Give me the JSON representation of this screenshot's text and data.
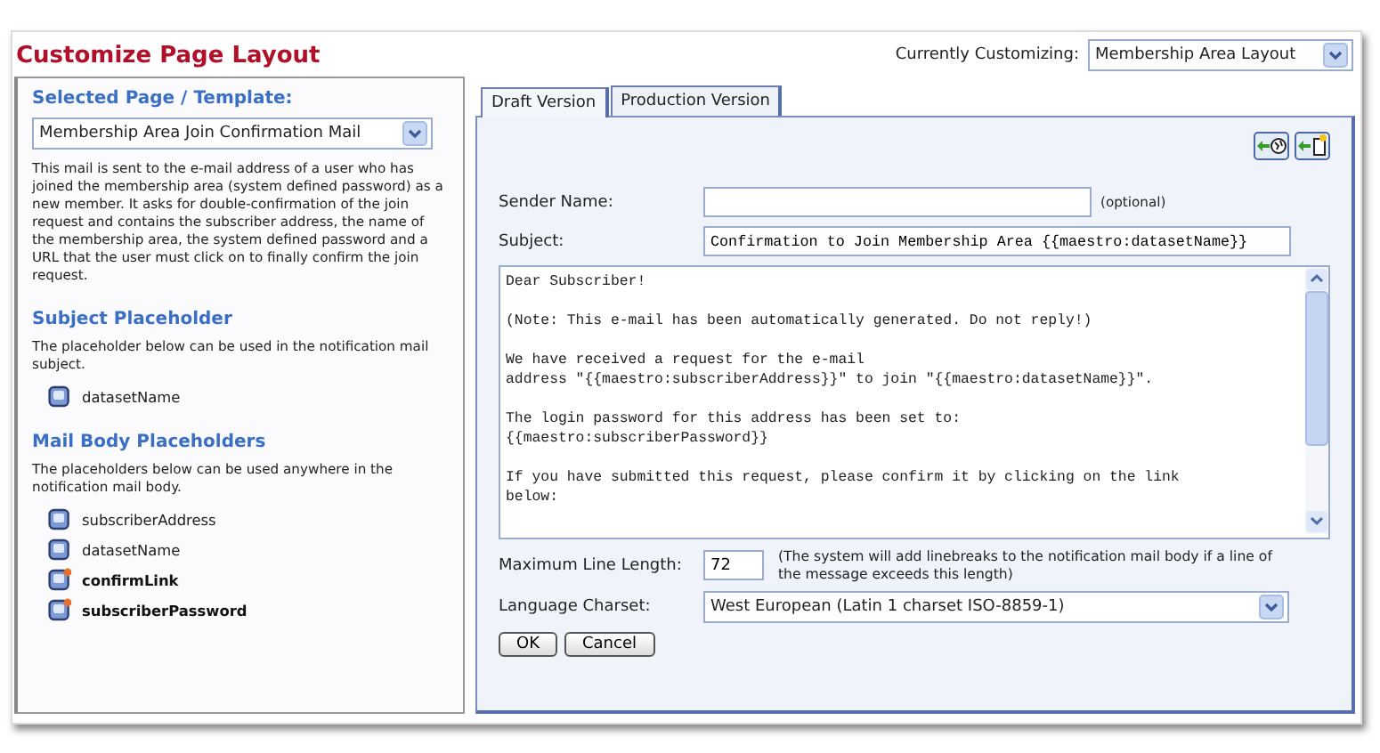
{
  "title": "Customize Page Layout",
  "customizing": {
    "label": "Currently Customizing:",
    "value": "Membership Area Layout"
  },
  "sidebar": {
    "heading": "Selected Page / Template:",
    "template": "Membership Area Join Confirmation Mail",
    "description": "This mail is sent to the e-mail address of a user who has joined the membership area (system defined password) as a new member. It asks for double-confirmation of the join request and contains the subscriber address, the name of the membership area, the system defined password and a URL that the user must click on to finally confirm the join request.",
    "sections": [
      {
        "heading": "Subject Placeholder",
        "note": "The placeholder below can be used in the notification mail subject.",
        "items": [
          {
            "label": "datasetName",
            "required": false
          }
        ]
      },
      {
        "heading": "Mail Body Placeholders",
        "note": "The placeholders below can be used anywhere in the notification mail body.",
        "items": [
          {
            "label": "subscriberAddress",
            "required": false
          },
          {
            "label": "datasetName",
            "required": false
          },
          {
            "label": "confirmLink",
            "required": true
          },
          {
            "label": "subscriberPassword",
            "required": true
          }
        ]
      }
    ]
  },
  "tabs": [
    {
      "label": "Draft Version",
      "selected": true
    },
    {
      "label": "Production Version",
      "selected": false
    }
  ],
  "form": {
    "sender": {
      "label": "Sender Name:",
      "hint": "(optional)"
    },
    "subject": {
      "label": "Subject:",
      "value": "Confirmation to Join Membership Area {{maestro:datasetName}}"
    },
    "body": [
      [
        "Dear Subscriber!"
      ],
      [
        "(Note: This e-mail has been automatically generated. Do not reply!)"
      ],
      [
        "We have received a request for the e-mail",
        "address \"{{maestro:subscriberAddress}}\" to join \"{{maestro:datasetName}}\"."
      ],
      [
        "The login password for this address has been set to:",
        "{{maestro:subscriberPassword}}"
      ],
      [
        "If you have submitted this request, please confirm it by clicking on the link",
        "below:"
      ]
    ],
    "max_line": {
      "label": "Maximum Line Length:",
      "value": "72",
      "hint": "(The system will add linebreaks to the notification mail body if a line of the message exceeds this length)"
    },
    "charset": {
      "label": "Language Charset:",
      "value": "West European (Latin 1 charset ISO-8859-1)"
    },
    "buttons": [
      "OK",
      "Cancel"
    ]
  }
}
